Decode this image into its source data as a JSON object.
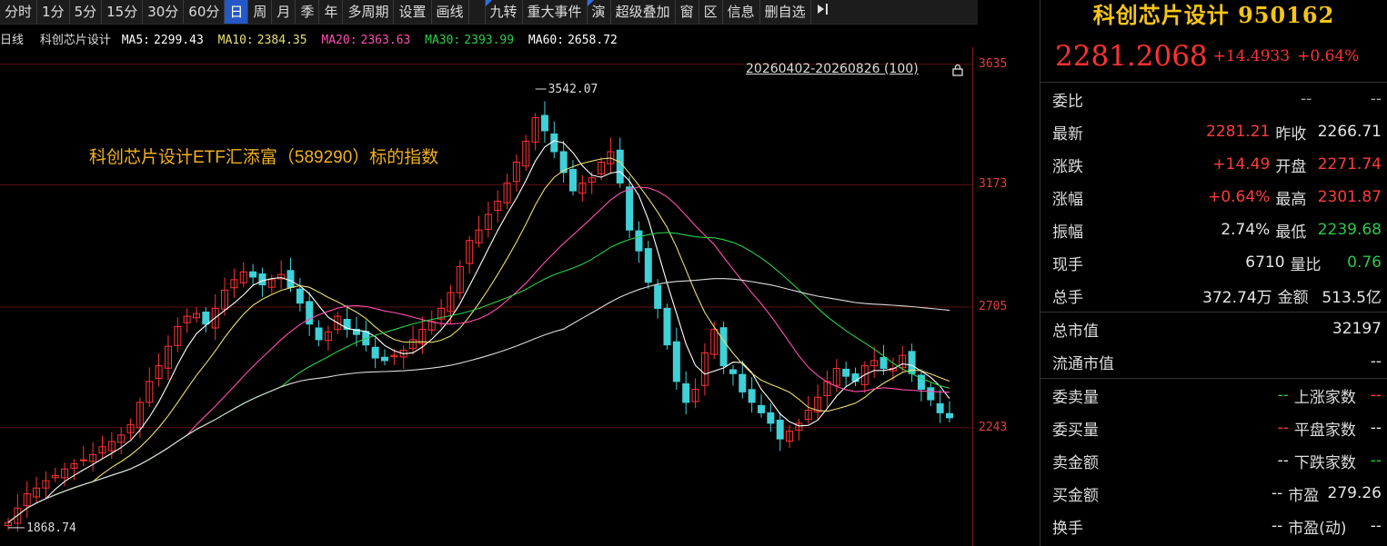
{
  "toolbar": {
    "items": [
      {
        "label": "分时"
      },
      {
        "label": "1分"
      },
      {
        "label": "5分"
      },
      {
        "label": "15分"
      },
      {
        "label": "30分"
      },
      {
        "label": "60分"
      },
      {
        "label": "日",
        "active": true
      },
      {
        "label": "周"
      },
      {
        "label": "月"
      },
      {
        "label": "季"
      },
      {
        "label": "年"
      },
      {
        "label": "多周期"
      },
      {
        "label": "设置"
      },
      {
        "label": "画线"
      }
    ],
    "items2": [
      {
        "label": "九转",
        "flag": true
      },
      {
        "label": "重大事件",
        "flag": false
      },
      {
        "label": "演",
        "flag": true
      },
      {
        "label": "超级叠加"
      },
      {
        "label": "窗"
      },
      {
        "label": "区"
      },
      {
        "label": "信息"
      },
      {
        "label": "删自选"
      }
    ],
    "collapse_icon": "collapse-right-icon"
  },
  "ma_line": {
    "period": "日线",
    "name": "科创芯片设计",
    "ma5_label": "MA5:",
    "ma5": "2299.43",
    "ma10_label": "MA10:",
    "ma10": "2384.35",
    "ma20_label": "MA20:",
    "ma20": "2363.63",
    "ma30_label": "MA30:",
    "ma30": "2393.99",
    "ma60_label": "MA60:",
    "ma60": "2658.72",
    "colors": {
      "ma5": "#ffffff",
      "ma10": "#e8e070",
      "ma20": "#ff4fb0",
      "ma30": "#29d04a",
      "ma60": "#dcdcdc"
    }
  },
  "chart": {
    "range_label": "20260402-20260826 (100)",
    "note": "科创芯片设计ETF汇添富（589290）标的指数",
    "y_ticks": [
      "3635",
      "3173",
      "2705",
      "2243"
    ],
    "high_label": "3542.07",
    "low_label": "1868.74",
    "colors": {
      "up": "#ff3333",
      "down": "#3fd0d8",
      "grid": "#5a1010"
    }
  },
  "chart_data": {
    "type": "candlestick",
    "series": [
      {
        "name": "MA5",
        "color": "#ffffff"
      },
      {
        "name": "MA10",
        "color": "#e8e070"
      },
      {
        "name": "MA20",
        "color": "#ff4fb0"
      },
      {
        "name": "MA30",
        "color": "#29d04a"
      },
      {
        "name": "MA60",
        "color": "#dcdcdc"
      }
    ],
    "close": [
      1880,
      1935,
      1990,
      2012,
      2040,
      2060,
      2085,
      2105,
      2120,
      2140,
      2170,
      2190,
      2215,
      2255,
      2340,
      2420,
      2480,
      2555,
      2630,
      2670,
      2680,
      2640,
      2700,
      2770,
      2810,
      2840,
      2820,
      2790,
      2810,
      2830,
      2780,
      2720,
      2640,
      2580,
      2610,
      2670,
      2620,
      2600,
      2560,
      2510,
      2500,
      2520,
      2540,
      2580,
      2620,
      2650,
      2700,
      2760,
      2860,
      2960,
      3000,
      3060,
      3110,
      3180,
      3260,
      3340,
      3430,
      3380,
      3300,
      3220,
      3150,
      3180,
      3200,
      3260,
      3300,
      3180,
      3000,
      2920,
      2800,
      2700,
      2560,
      2420,
      2340,
      2390,
      2530,
      2620,
      2480,
      2450,
      2380,
      2340,
      2300,
      2260,
      2200,
      2230,
      2260,
      2310,
      2360,
      2420,
      2470,
      2440,
      2420,
      2480,
      2500,
      2470,
      2470,
      2520,
      2450,
      2390,
      2350,
      2300,
      2281
    ],
    "ylim": [
      1790,
      3700
    ]
  },
  "quote": {
    "title": "科创芯片设计 950162",
    "price": "2281.2068",
    "change": "+14.4933",
    "pct": "+0.64%",
    "rows": [
      {
        "l1": "委比",
        "v1": "--",
        "c1": "dash",
        "l2": "",
        "v2": "--",
        "c2": "dash"
      },
      {
        "l1": "最新",
        "v1": "2281.21",
        "c1": "red",
        "l2": "昨收",
        "v2": "2266.71",
        "c2": "white"
      },
      {
        "l1": "涨跌",
        "v1": "+14.49",
        "c1": "red",
        "l2": "开盘",
        "v2": "2271.74",
        "c2": "red"
      },
      {
        "l1": "涨幅",
        "v1": "+0.64%",
        "c1": "red",
        "l2": "最高",
        "v2": "2301.87",
        "c2": "red"
      },
      {
        "l1": "振幅",
        "v1": "2.74%",
        "c1": "white",
        "l2": "最低",
        "v2": "2239.68",
        "c2": "green"
      },
      {
        "l1": "现手",
        "v1": "6710",
        "c1": "white",
        "l2": "量比",
        "v2": "0.76",
        "c2": "green"
      },
      {
        "l1": "总手",
        "v1": "372.74万",
        "c1": "white",
        "l2": "金额",
        "v2": "513.5亿",
        "c2": "white"
      }
    ],
    "wide_rows": [
      {
        "l": "总市值",
        "v": "32197"
      },
      {
        "l": "流通市值",
        "v": "--"
      }
    ],
    "rows2": [
      {
        "l1": "委卖量",
        "v1": "--",
        "c1": "green",
        "l2": "上涨家数",
        "v2": "--",
        "c2": "red"
      },
      {
        "l1": "委买量",
        "v1": "--",
        "c1": "red",
        "l2": "平盘家数",
        "v2": "--",
        "c2": "white"
      },
      {
        "l1": "卖金额",
        "v1": "--",
        "c1": "white",
        "l2": "下跌家数",
        "v2": "--",
        "c2": "green"
      },
      {
        "l1": "买金额",
        "v1": "--",
        "c1": "white",
        "l2": "市盈",
        "v2": "279.26",
        "c2": "white"
      },
      {
        "l1": "换手",
        "v1": "--",
        "c1": "white",
        "l2": "市盈(动)",
        "v2": "--",
        "c2": "white"
      }
    ]
  }
}
